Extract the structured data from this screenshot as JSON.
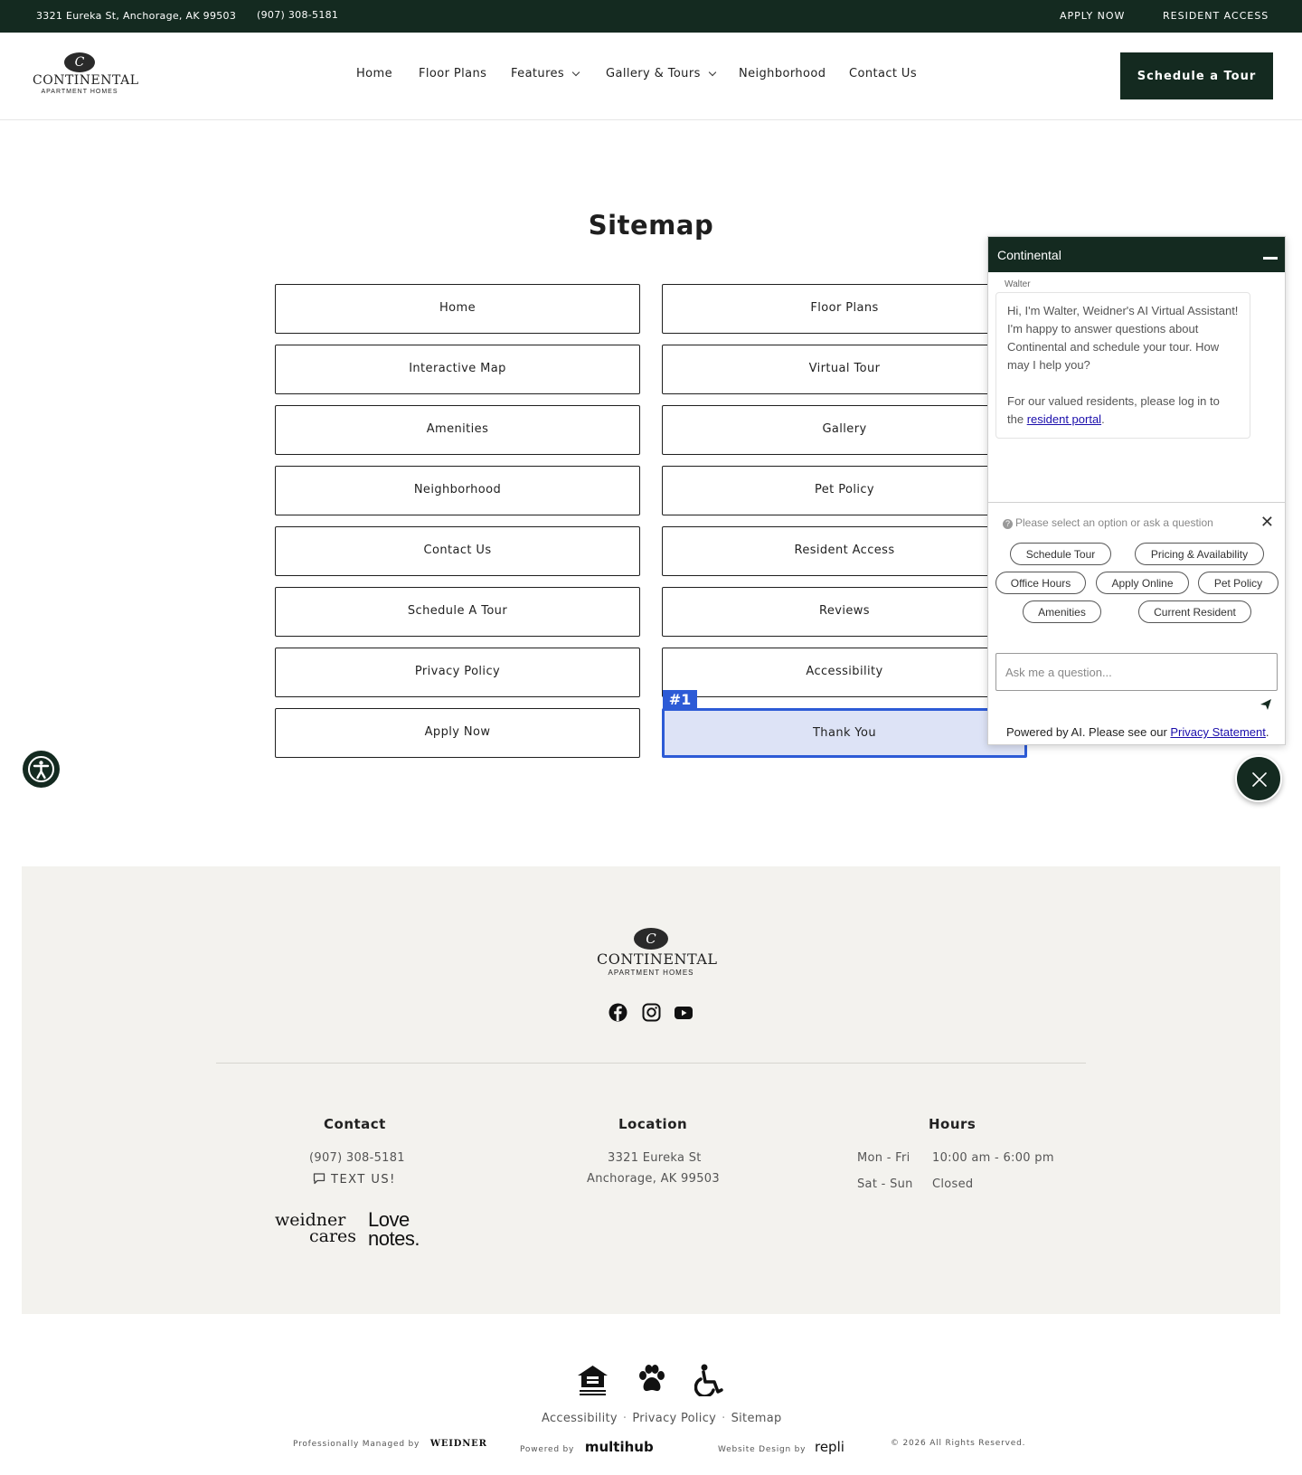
{
  "topbar": {
    "address": "3321 Eureka St, Anchorage, AK 99503",
    "phone": "(907) 308-5181",
    "apply": "APPLY NOW",
    "resident": "RESIDENT ACCESS"
  },
  "logo": {
    "emblem": "C",
    "word": "CONTINENTAL",
    "sub": "APARTMENT HOMES"
  },
  "nav": {
    "items": [
      "Home",
      "Floor Plans",
      "Features",
      "Gallery & Tours",
      "Neighborhood",
      "Contact Us"
    ],
    "cta": "Schedule a Tour"
  },
  "sitemap": {
    "title": "Sitemap",
    "left": [
      "Home",
      "Interactive Map",
      "Amenities",
      "Neighborhood",
      "Contact Us",
      "Schedule A Tour",
      "Privacy Policy",
      "Apply Now"
    ],
    "right": [
      "Floor Plans",
      "Virtual Tour",
      "Gallery",
      "Pet Policy",
      "Resident Access",
      "Reviews",
      "Accessibility",
      "Thank You"
    ],
    "highlight_badge": "#1"
  },
  "chat": {
    "title": "Continental",
    "sender": "Walter",
    "message_1": "Hi, I'm Walter, Weidner's AI Virtual Assistant! I'm happy to answer questions about Continental and schedule your tour. How may I help you?",
    "message_2_prefix": "For our valued residents, please log in to the ",
    "message_2_link": "resident portal",
    "message_2_suffix": ".",
    "prompt": "Please select an option or ask a question",
    "chips": [
      "Schedule Tour",
      "Pricing & Availability",
      "Office Hours",
      "Apply Online",
      "Pet Policy",
      "Amenities",
      "Current Resident"
    ],
    "input_placeholder": "Ask me a question...",
    "footer_prefix": "Powered by AI. Please see our ",
    "footer_link": "Privacy Statement",
    "footer_suffix": "."
  },
  "footer": {
    "contact": {
      "title": "Contact",
      "phone": "(907) 308-5181",
      "text_us": "TEXT US!"
    },
    "location": {
      "title": "Location",
      "line1": "3321 Eureka St",
      "line2": "Anchorage, AK 99503"
    },
    "hours": {
      "title": "Hours",
      "rows": [
        {
          "days": "Mon - Fri",
          "time": "10:00 am - 6:00 pm"
        },
        {
          "days": "Sat - Sun",
          "time": "Closed"
        }
      ]
    },
    "brands": {
      "weidner_1": "weidner",
      "weidner_2": "cares",
      "love_1": "Love",
      "love_2": "notes."
    }
  },
  "legal": {
    "links": [
      "Accessibility",
      "Privacy Policy",
      "Sitemap"
    ],
    "managed_by": "Professionally Managed by",
    "managed_mark": "WEIDNER",
    "powered_by": "Powered by",
    "powered_mark": "multihub",
    "design_by": "Website Design by",
    "design_mark": "repli",
    "copyright": "© 2026 All Rights Reserved."
  },
  "colors": {
    "brand_dark": "#142a20",
    "highlight": "#2d5bd6",
    "highlight_fill": "#dde3f6",
    "footer_bg": "#f3f2ee"
  },
  "icons": [
    "accessibility-icon",
    "minimize-icon",
    "help-icon",
    "close-icon",
    "send-icon",
    "facebook-icon",
    "instagram-icon",
    "youtube-icon",
    "chat-bubble-icon",
    "equal-housing-icon",
    "pet-paw-icon",
    "wheelchair-icon"
  ]
}
